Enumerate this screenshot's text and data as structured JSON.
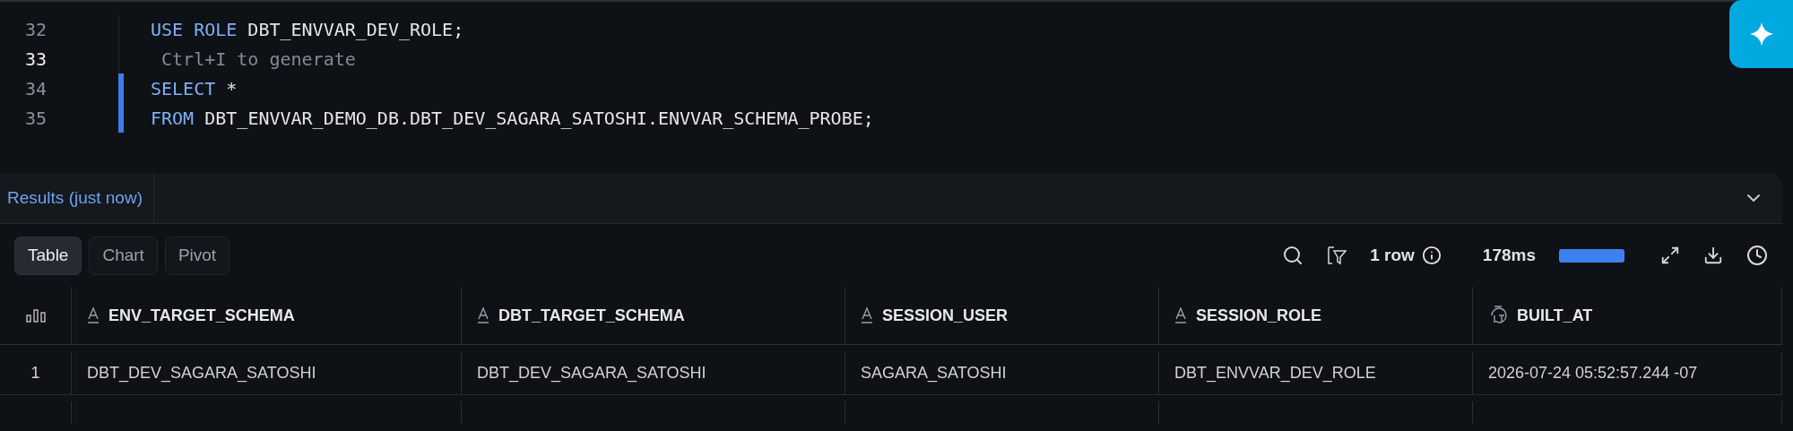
{
  "editor": {
    "lines": [
      {
        "number": "32",
        "current": false,
        "changed": false,
        "tokens": [
          {
            "kind": "keyword",
            "text": "USE ROLE"
          },
          {
            "kind": "plain",
            "text": " DBT_ENVVAR_DEV_ROLE;"
          }
        ]
      },
      {
        "number": "33",
        "current": true,
        "changed": false,
        "tokens": [
          {
            "kind": "hint",
            "text": " Ctrl+I to generate"
          }
        ]
      },
      {
        "number": "34",
        "current": false,
        "changed": true,
        "tokens": [
          {
            "kind": "keyword",
            "text": "SELECT"
          },
          {
            "kind": "plain",
            "text": " *"
          }
        ]
      },
      {
        "number": "35",
        "current": false,
        "changed": true,
        "tokens": [
          {
            "kind": "keyword",
            "text": "FROM"
          },
          {
            "kind": "plain",
            "text": " DBT_ENVVAR_DEMO_DB.DBT_DEV_SAGARA_SATOSHI.ENVVAR_SCHEMA_PROBE;"
          }
        ]
      }
    ]
  },
  "results": {
    "title": "Results (just now)",
    "views": [
      {
        "label": "Table",
        "selected": true
      },
      {
        "label": "Chart",
        "selected": false
      },
      {
        "label": "Pivot",
        "selected": false
      }
    ],
    "row_count": "1 row",
    "duration": "178ms",
    "progress": {
      "level": 1
    },
    "table": {
      "columns": [
        {
          "label": "ENV_TARGET_SCHEMA",
          "kind": "text"
        },
        {
          "label": "DBT_TARGET_SCHEMA",
          "kind": "text"
        },
        {
          "label": "SESSION_USER",
          "kind": "text"
        },
        {
          "label": "SESSION_ROLE",
          "kind": "text"
        },
        {
          "label": "BUILT_AT",
          "kind": "timestamp"
        }
      ],
      "rows": [
        {
          "number": "1",
          "cells": [
            "DBT_DEV_SAGARA_SATOSHI",
            "DBT_DEV_SAGARA_SATOSHI",
            "SAGARA_SATOSHI",
            "DBT_ENVVAR_DEV_ROLE",
            "2026-07-24 05:52:57.244 -07"
          ]
        }
      ]
    }
  }
}
